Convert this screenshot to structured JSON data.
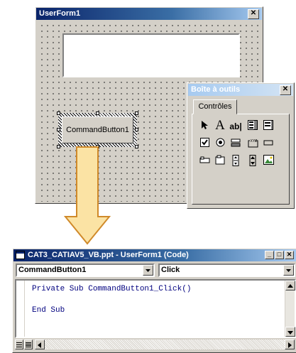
{
  "userform": {
    "title": "UserForm1",
    "close_glyph": "✕",
    "button_label": "CommandButton1"
  },
  "toolbox": {
    "title": "Boîte à outils",
    "close_glyph": "✕",
    "tab_label": "Contrôles"
  },
  "code_window": {
    "title": "CAT3_CATIAV5_VB.ppt - UserForm1 (Code)",
    "object_combo": "CommandButton1",
    "procedure_combo": "Click",
    "lines": [
      "Private Sub CommandButton1_Click()",
      "",
      "End Sub"
    ],
    "minimize": "_",
    "maximize": "□",
    "close": "✕"
  },
  "colors": {
    "arrow_fill": "#fbe3a4",
    "arrow_stroke": "#d08a2a",
    "title_dark": "#0a246a",
    "title_light": "#a6caf0",
    "face": "#d4d0c8"
  },
  "icons": [
    "pointer-icon",
    "label-icon",
    "textbox-icon",
    "combobox-icon",
    "listbox-icon",
    "checkbox-icon",
    "optionbutton-icon",
    "togglebutton-icon",
    "frame-icon",
    "commandbutton-icon",
    "tabstrip-icon",
    "multipage-icon",
    "scrollbar-icon",
    "spinbutton-icon",
    "image-icon"
  ]
}
